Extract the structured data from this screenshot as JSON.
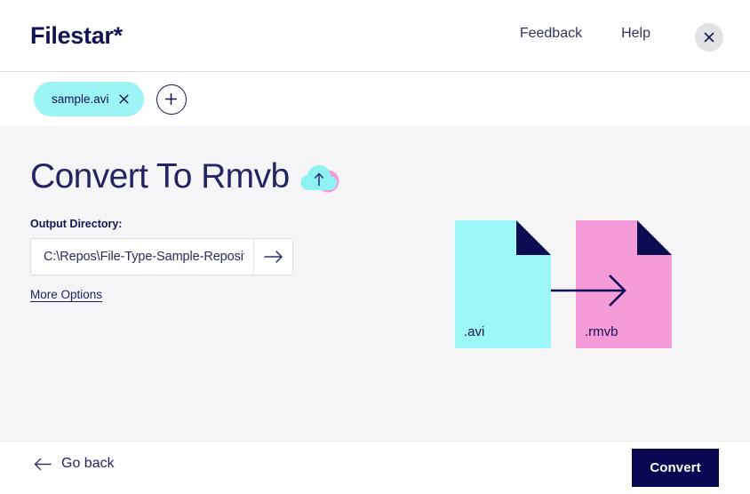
{
  "header": {
    "brand": "Filestar*",
    "nav": [
      {
        "label": "Feedback",
        "name": "nav-link-feedback"
      },
      {
        "label": "Help",
        "name": "nav-link-help"
      }
    ],
    "close_icon": "close-icon"
  },
  "tabstrip": {
    "files": [
      {
        "label": "sample.avi",
        "close_icon": "close-icon"
      }
    ],
    "add_icon": "plus-icon",
    "add_label": "+"
  },
  "main": {
    "title": "Convert To Rmvb",
    "title_icon": "cloud-upload-icon",
    "output_directory": {
      "label": "Output Directory:",
      "value": "C:\\Repos\\File-Type-Sample-Reposit",
      "placeholder": "Output directory",
      "go_icon": "arrow-right-icon"
    },
    "more_options": "More Options"
  },
  "illustration": {
    "source": {
      "extension": ".avi",
      "color": "#9DF7F7"
    },
    "target": {
      "extension": ".rmvb",
      "color": "#F59BD8"
    },
    "fold_color": "#0B0B52",
    "arrow_color": "#0B0B52",
    "arrow_icon": "arrow-right-icon"
  },
  "footer": {
    "back_label": "Go back",
    "back_icon": "arrow-left-icon",
    "convert_label": "Convert",
    "convert_color": "#080852"
  },
  "colors": {
    "brand_navy": "#141454",
    "chip_cyan": "#9DF4F4",
    "accent_pink": "#F59BD8",
    "page_bg": "#F5F5F8"
  }
}
